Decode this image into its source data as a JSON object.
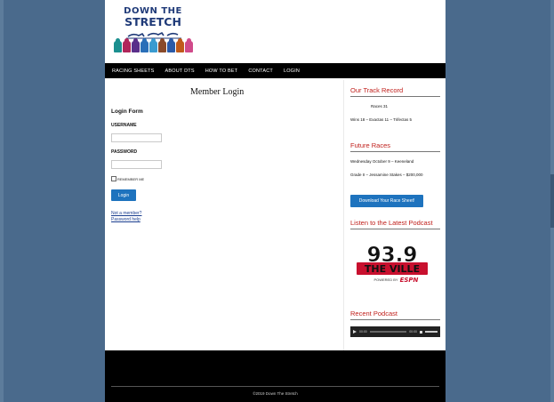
{
  "site": {
    "logo_line1": "DOWN THE",
    "logo_line2": "STRETCH",
    "silk_colors": [
      "#1b8f8f",
      "#b0265a",
      "#5a2f8a",
      "#2a6fb8",
      "#3a9bd0",
      "#8a4a2a",
      "#2a5aa8",
      "#c05a1a",
      "#d04a8a"
    ]
  },
  "nav": [
    "RACING SHEETS",
    "ABOUT DTS",
    "HOW TO BET",
    "CONTACT",
    "LOGIN"
  ],
  "main": {
    "title": "Member Login",
    "form_title": "Login Form",
    "username_label": "USERNAME",
    "password_label": "PASSWORD",
    "remember_label": "REMEMBER ME",
    "login_button": "Login",
    "not_member_link": "Not a member?",
    "password_help_link": "Password help"
  },
  "sidebar": {
    "track_record_title": "Our Track Record",
    "races": "Races 31",
    "stats": "Wins 18 – Exactas 11 – Trifectas 5",
    "future_title": "Future Races",
    "future_date": "Wednesday October 9 – Keeneland",
    "future_race": "Grade II – Jessamine Stakes – $200,000",
    "download_button": "Download Your Race Sheet!",
    "podcast_title": "Listen to the Latest Podcast",
    "radio_freq": "93.9",
    "radio_name": "THE VILLE",
    "radio_powered": "POWERED BY",
    "radio_brand": "ESPN",
    "recent_title": "Recent Podcast",
    "time_current": "00:00",
    "time_total": "00:00"
  },
  "footer": {
    "copyright": "©2019 Down The Stretch"
  }
}
